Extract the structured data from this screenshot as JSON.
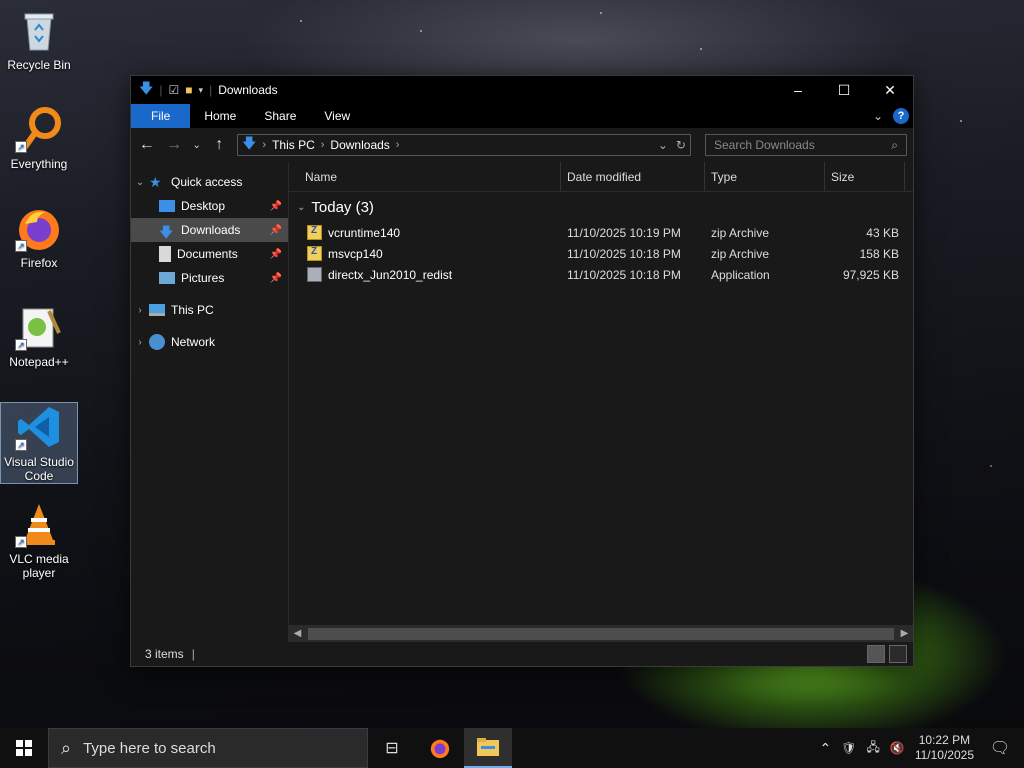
{
  "desktop": {
    "icons": [
      {
        "label": "Recycle Bin"
      },
      {
        "label": "Everything"
      },
      {
        "label": "Firefox"
      },
      {
        "label": "Notepad++"
      },
      {
        "label": "Visual Studio Code"
      },
      {
        "label": "VLC media player"
      }
    ]
  },
  "window": {
    "title": "Downloads",
    "ribbon": {
      "file": "File",
      "home": "Home",
      "share": "Share",
      "view": "View"
    },
    "address": {
      "crumbs": [
        "This PC",
        "Downloads"
      ]
    },
    "search_placeholder": "Search Downloads",
    "nav": {
      "quick_access": "Quick access",
      "desktop": "Desktop",
      "downloads": "Downloads",
      "documents": "Documents",
      "pictures": "Pictures",
      "this_pc": "This PC",
      "network": "Network"
    },
    "columns": {
      "name": "Name",
      "date": "Date modified",
      "type": "Type",
      "size": "Size"
    },
    "group": "Today (3)",
    "files": [
      {
        "name": "vcruntime140",
        "date": "11/10/2025 10:19 PM",
        "type": "zip Archive",
        "size": "43 KB",
        "icon": "zip-icon"
      },
      {
        "name": "msvcp140",
        "date": "11/10/2025 10:18 PM",
        "type": "zip Archive",
        "size": "158 KB",
        "icon": "zip-icon"
      },
      {
        "name": "directx_Jun2010_redist",
        "date": "11/10/2025 10:18 PM",
        "type": "Application",
        "size": "97,925 KB",
        "icon": "application-icon"
      }
    ],
    "status": "3 items"
  },
  "taskbar": {
    "search_placeholder": "Type here to search",
    "time": "10:22 PM",
    "date": "11/10/2025"
  },
  "colors": {
    "accent": "#1a68c9",
    "window_bg": "#191919",
    "titlebar": "#000000"
  }
}
